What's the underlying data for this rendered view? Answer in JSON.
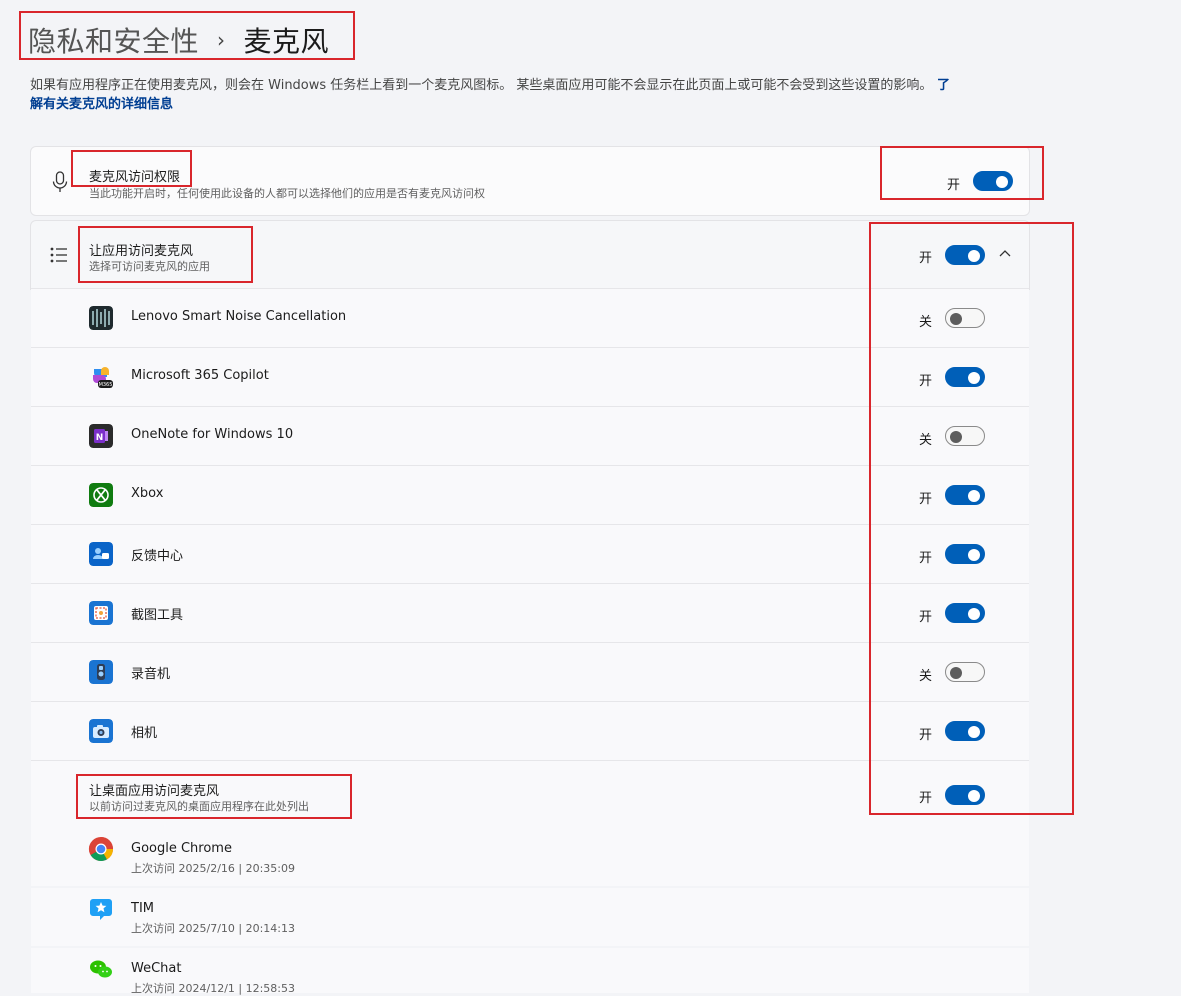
{
  "breadcrumb": {
    "parent": "隐私和安全性",
    "separator": "›",
    "current": "麦克风"
  },
  "description": {
    "text": "如果有应用程序正在使用麦克风，则会在 Windows 任务栏上看到一个麦克风图标。 某些桌面应用可能不会显示在此页面上或可能不会受到这些设置的影响。",
    "link_prefix": " 了",
    "link_rest": "解有关麦克风的详细信息"
  },
  "mic_access": {
    "title": "麦克风访问权限",
    "subtitle": "当此功能开启时，任何使用此设备的人都可以选择他们的应用是否有麦克风访问权",
    "state": "开",
    "on": true,
    "icon": "microphone-icon"
  },
  "apps_access": {
    "title": "让应用访问麦克风",
    "subtitle": "选择可访问麦克风的应用",
    "state": "开",
    "on": true,
    "icon": "app-list-icon"
  },
  "apps": [
    {
      "name": "Lenovo Smart Noise Cancellation",
      "state": "关",
      "on": false,
      "icon": "lenovo-snc-icon"
    },
    {
      "name": "Microsoft 365 Copilot",
      "state": "开",
      "on": true,
      "icon": "m365-copilot-icon"
    },
    {
      "name": "OneNote for Windows 10",
      "state": "关",
      "on": false,
      "icon": "onenote-icon"
    },
    {
      "name": "Xbox",
      "state": "开",
      "on": true,
      "icon": "xbox-icon"
    },
    {
      "name": "反馈中心",
      "state": "开",
      "on": true,
      "icon": "feedback-hub-icon"
    },
    {
      "name": "截图工具",
      "state": "开",
      "on": true,
      "icon": "snipping-tool-icon"
    },
    {
      "name": "录音机",
      "state": "关",
      "on": false,
      "icon": "sound-recorder-icon"
    },
    {
      "name": "相机",
      "state": "开",
      "on": true,
      "icon": "camera-icon"
    }
  ],
  "desktop_access": {
    "title": "让桌面应用访问麦克风",
    "subtitle": "以前访问过麦克风的桌面应用程序在此处列出",
    "state": "开",
    "on": true
  },
  "desktop_apps": [
    {
      "name": "Google Chrome",
      "last": "上次访问 2025/2/16  |  20:35:09",
      "icon": "chrome-icon"
    },
    {
      "name": "TIM",
      "last": "上次访问 2025/7/10  |  20:14:13",
      "icon": "tim-icon"
    },
    {
      "name": "WeChat",
      "last": "上次访问 2024/12/1  |  12:58:53",
      "icon": "wechat-icon"
    }
  ],
  "colors": {
    "accent": "#005fb8",
    "annotation": "#d9262c"
  }
}
